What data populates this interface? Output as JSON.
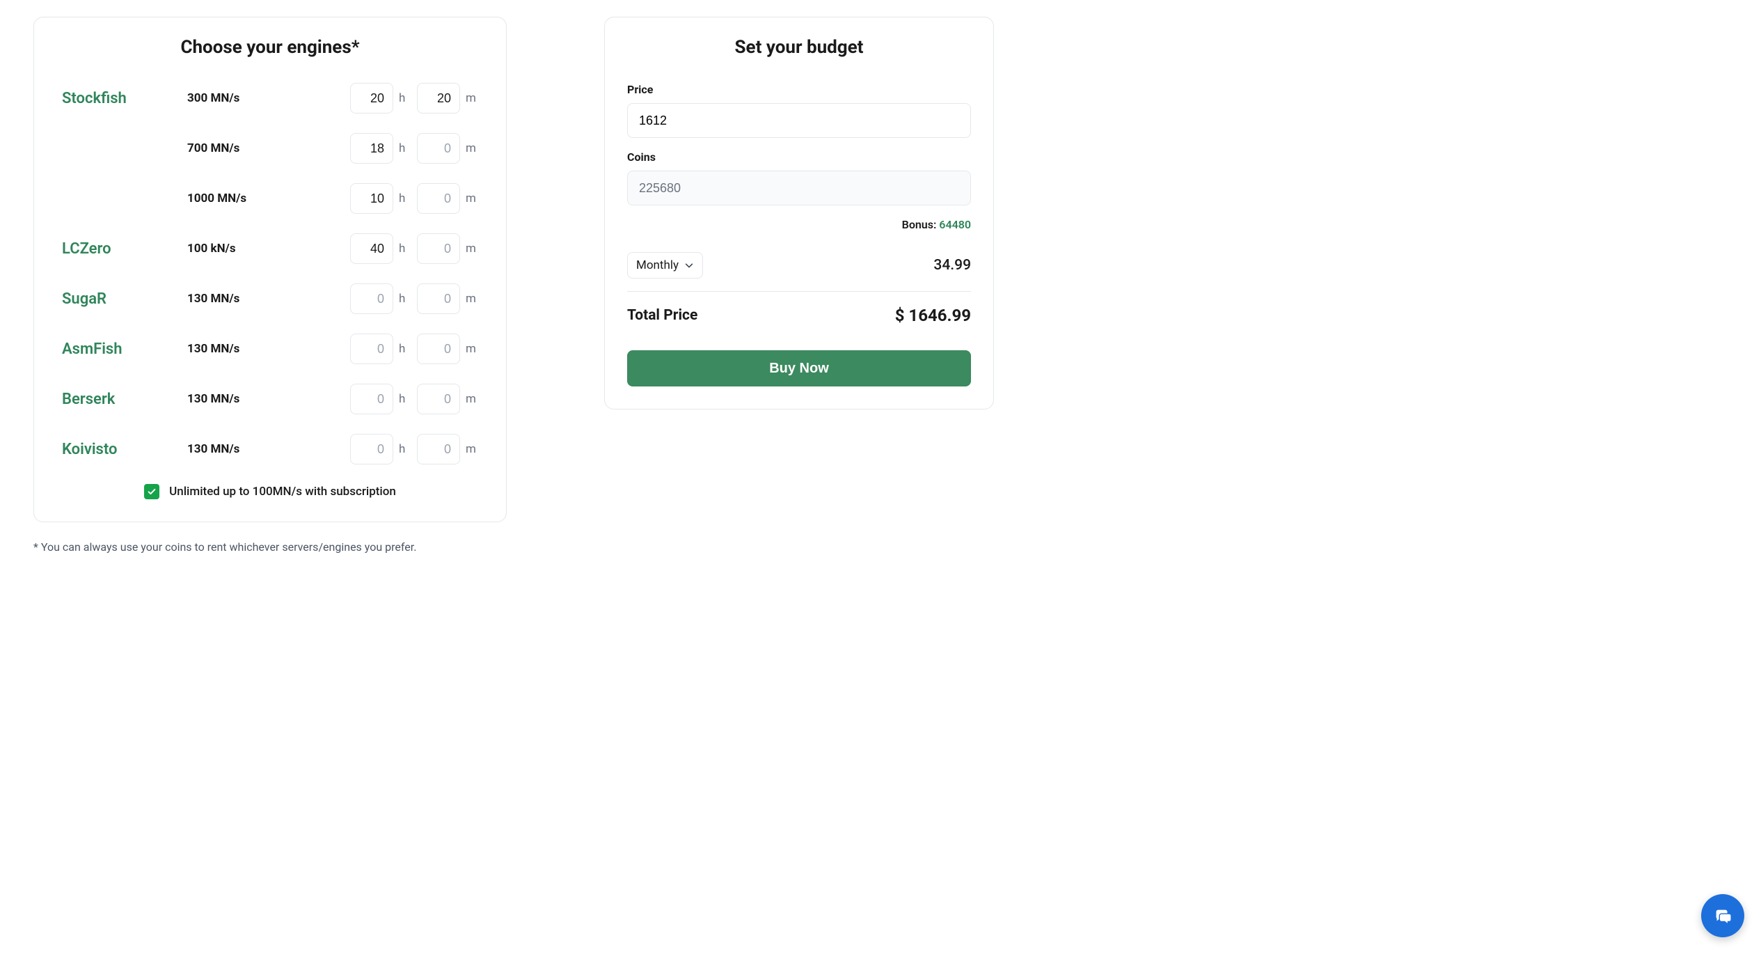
{
  "engines": {
    "title": "Choose your engines*",
    "rows": [
      {
        "name": "Stockfish",
        "speed": "300 MN/s",
        "h": "20",
        "m": "20"
      },
      {
        "name": "",
        "speed": "700 MN/s",
        "h": "18",
        "m": "0"
      },
      {
        "name": "",
        "speed": "1000 MN/s",
        "h": "10",
        "m": "0"
      },
      {
        "name": "LCZero",
        "speed": "100 kN/s",
        "h": "40",
        "m": "0"
      },
      {
        "name": "SugaR",
        "speed": "130 MN/s",
        "h": "0",
        "m": "0"
      },
      {
        "name": "AsmFish",
        "speed": "130 MN/s",
        "h": "0",
        "m": "0"
      },
      {
        "name": "Berserk",
        "speed": "130 MN/s",
        "h": "0",
        "m": "0"
      },
      {
        "name": "Koivisto",
        "speed": "130 MN/s",
        "h": "0",
        "m": "0"
      }
    ],
    "unit_h": "h",
    "unit_m": "m",
    "unlimited_label": "Unlimited up to 100MN/s with subscription",
    "unlimited_checked": true,
    "footnote": "* You can always use your coins to rent whichever servers/engines you prefer."
  },
  "budget": {
    "title": "Set your budget",
    "price_label": "Price",
    "price_value": "1612",
    "coins_label": "Coins",
    "coins_value": "225680",
    "bonus_label": "Bonus: ",
    "bonus_value": "64480",
    "plan_selected": "Monthly",
    "plan_price": "34.99",
    "total_label": "Total Price",
    "total_value": "$ 1646.99",
    "buy_label": "Buy Now"
  }
}
